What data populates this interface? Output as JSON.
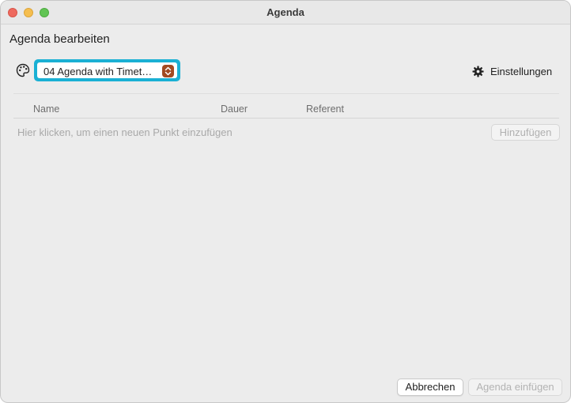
{
  "window": {
    "title": "Agenda"
  },
  "page": {
    "heading": "Agenda bearbeiten"
  },
  "toolbar": {
    "palette_icon": "palette-icon",
    "template_select": {
      "value": "04 Agenda with Timet…"
    },
    "settings": {
      "icon": "gear-icon",
      "label": "Einstellungen"
    }
  },
  "table": {
    "columns": [
      "Name",
      "Dauer",
      "Referent"
    ],
    "placeholder": "Hier klicken, um einen neuen Punkt einzufügen",
    "add_label": "Hinzufügen"
  },
  "footer": {
    "cancel_label": "Abbrechen",
    "insert_label": "Agenda einfügen"
  },
  "colors": {
    "focus_ring": "#1ab0d4",
    "select_arrow": "#a14a22",
    "close": "#ee6a5f",
    "minimize": "#f5be4f",
    "maximize": "#61c454"
  }
}
